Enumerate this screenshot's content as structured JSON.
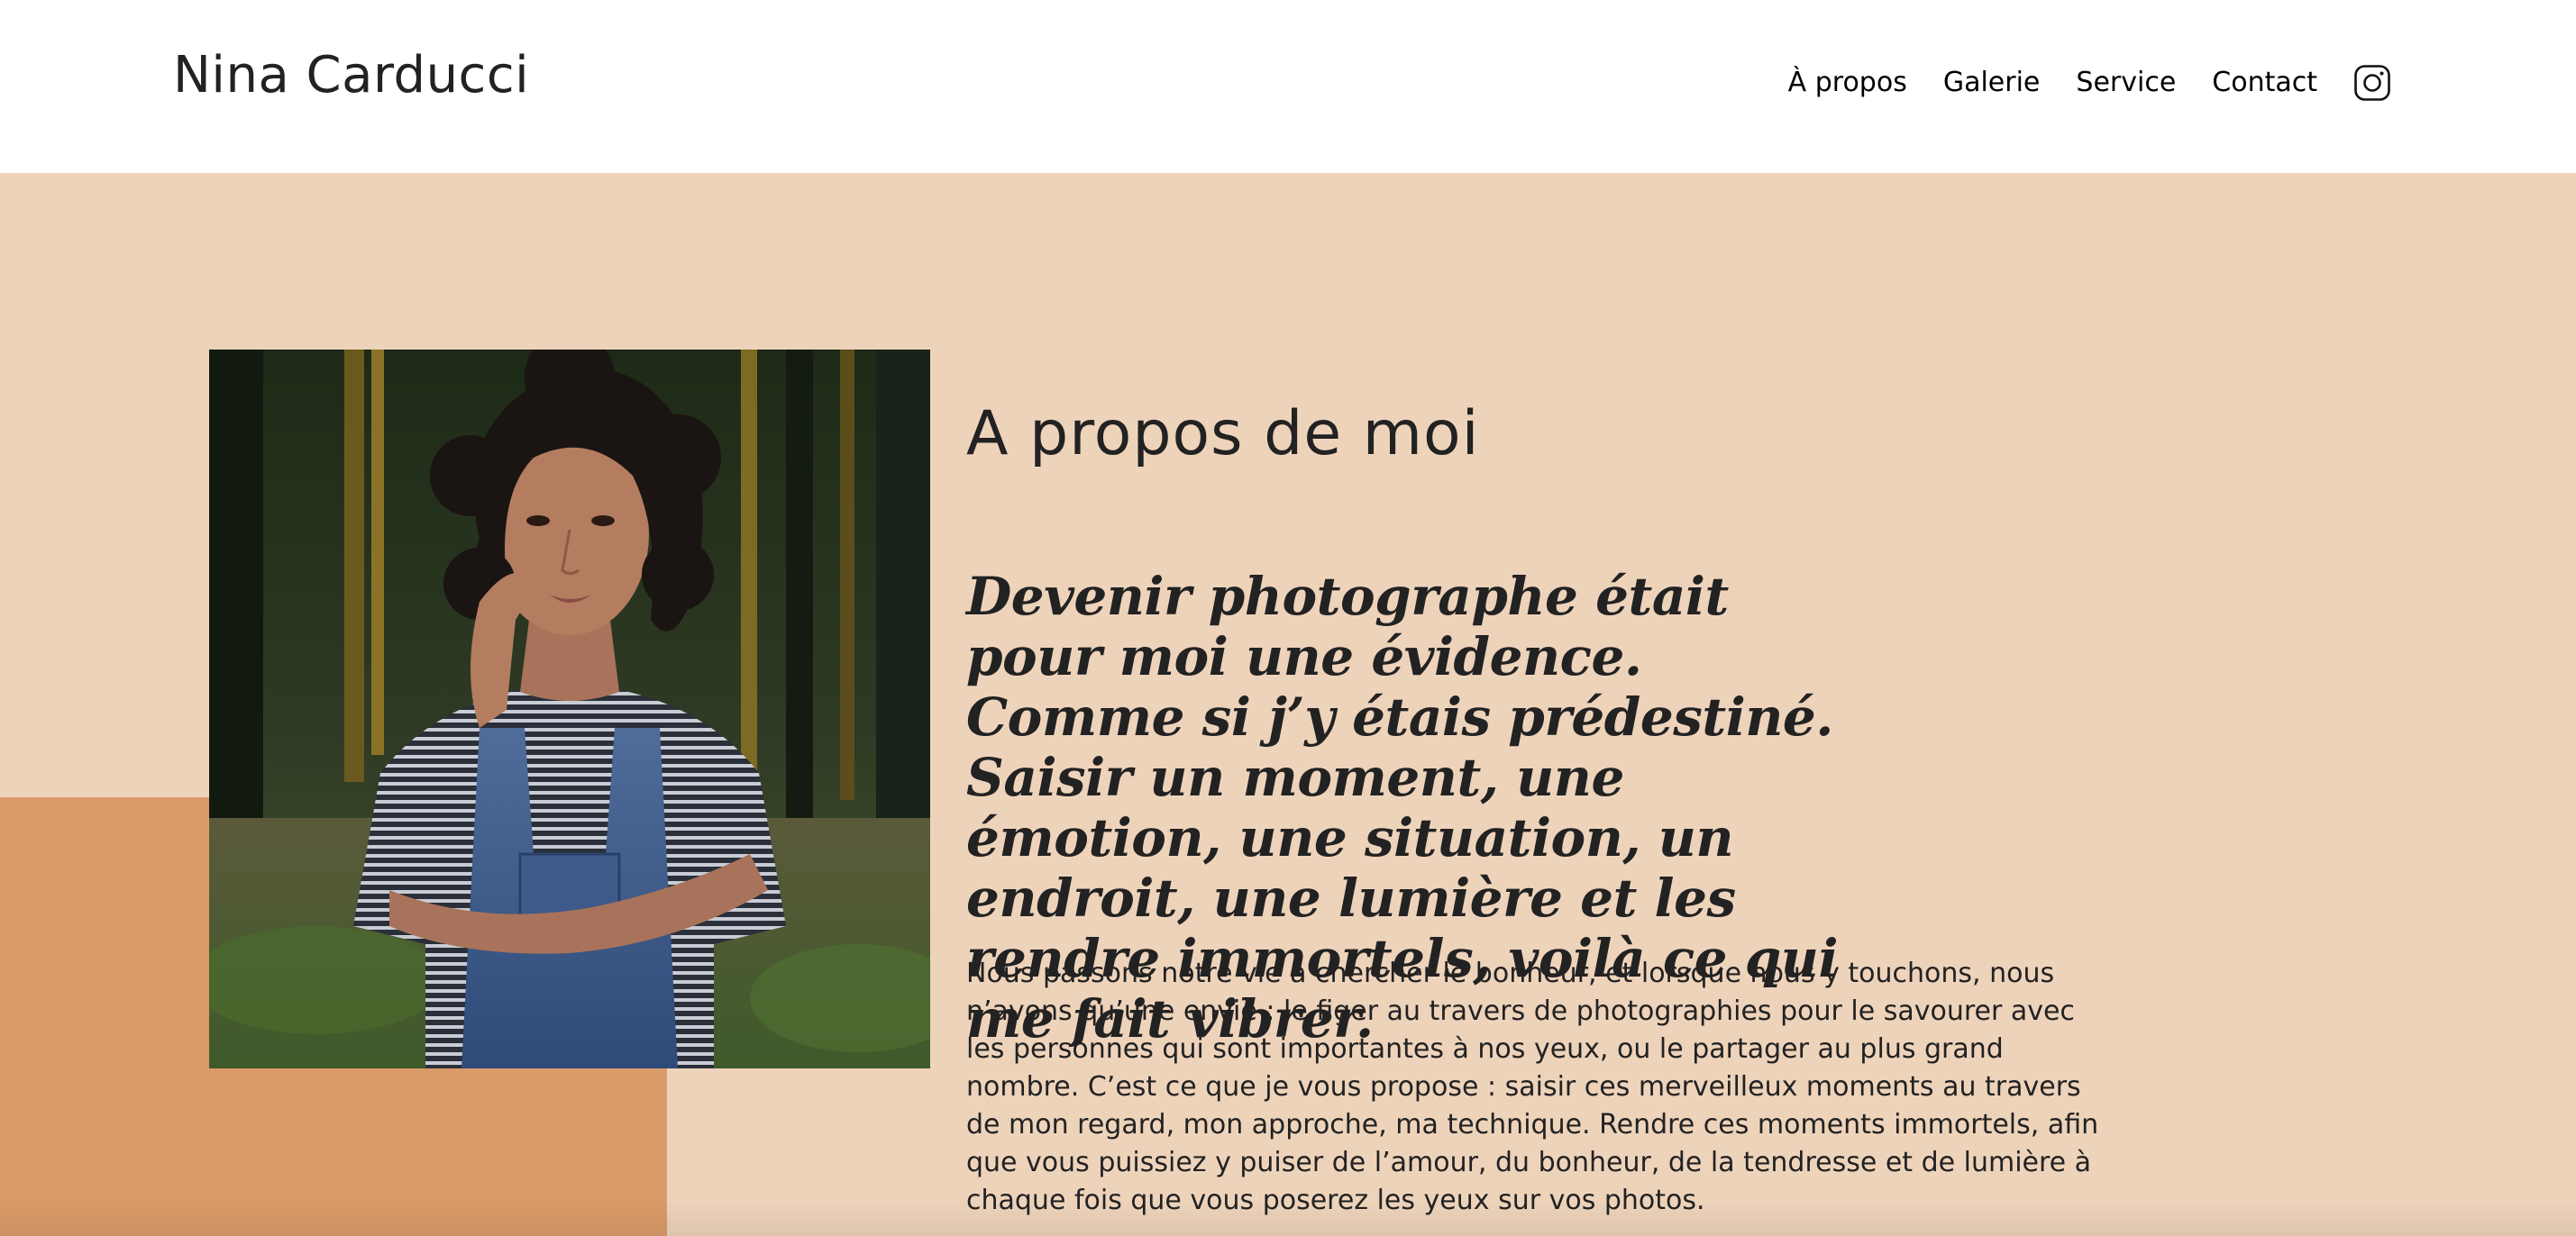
{
  "header": {
    "site_title": "Nina Carducci",
    "nav": {
      "about": "À propos",
      "gallery": "Galerie",
      "service": "Service",
      "contact": "Contact",
      "instagram_icon": "instagram-icon"
    }
  },
  "about": {
    "heading": "A propos de moi",
    "quote": "Devenir photographe était pour moi une évidence. Comme si j’y étais prédestiné. Saisir un moment, une émotion, une situation, un endroit, une lumière et les rendre immortels, voilà ce qui me fait vibrer.",
    "body": "Nous passons notre vie à chercher le bonheur, et lorsque nous y touchons, nous n’avons qu’une envie : le figer au travers de photographies pour le savourer avec les personnes qui sont importantes à nos yeux, ou le partager au plus grand nombre. C’est ce que je vous propose : saisir ces merveilleux moments au travers de mon regard, mon approche, ma technique. Rendre ces moments immortels, afin que vous puissiez y puiser de l’amour, du bonheur, de la tendresse et de lumière à chaque fois que vous poserez les yeux sur vos photos."
  },
  "colors": {
    "header_bg": "#ffffff",
    "section_bg": "#eed3bb",
    "accent": "#db9b69",
    "text": "#222222"
  }
}
